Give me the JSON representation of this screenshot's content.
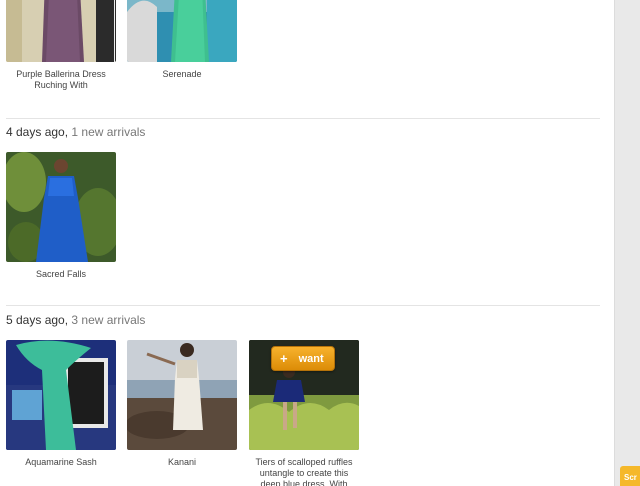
{
  "top_row": {
    "items": [
      {
        "caption": "Purple Ballerina Dress Ruching With"
      },
      {
        "caption": "Serenade"
      }
    ]
  },
  "sections": [
    {
      "ago": "4 days ago",
      "separator": ", ",
      "count": "1 new arrivals",
      "items": [
        {
          "caption": "Sacred Falls"
        }
      ]
    },
    {
      "ago": "5 days ago",
      "separator": ", ",
      "count": "3 new arrivals",
      "items": [
        {
          "caption": "Aquamarine Sash"
        },
        {
          "caption": "Kanani"
        },
        {
          "caption": "Tiers of scalloped ruffles untangle to create this deep blue dress. With"
        }
      ]
    }
  ],
  "want_button": {
    "label": "want",
    "icon": "plus-icon"
  },
  "scroll_tab": {
    "label": "Scr"
  },
  "colors": {
    "accent": "#f0a81f",
    "divider": "#e4e4e4"
  }
}
